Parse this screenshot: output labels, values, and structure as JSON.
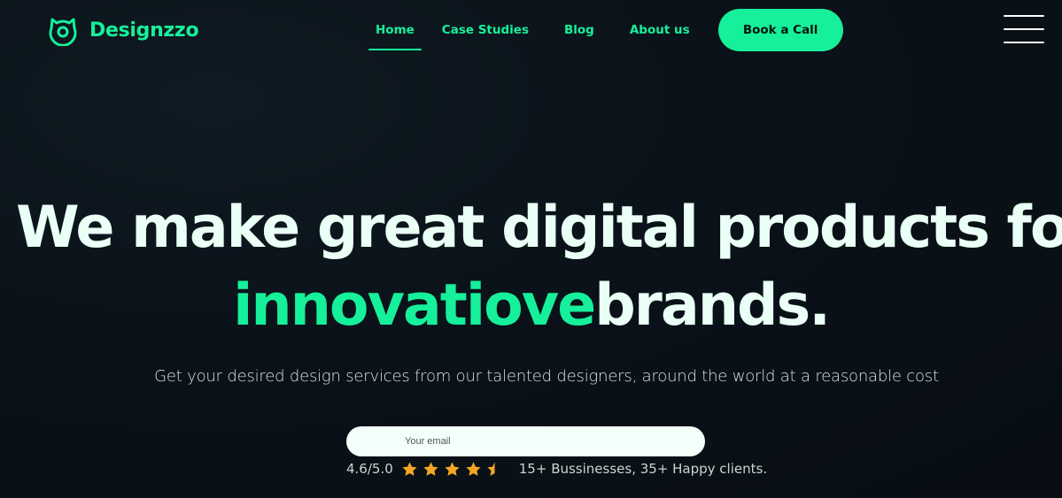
{
  "brand": {
    "name": "Designzzo",
    "accent": "#16f09a",
    "background": "#0a1118"
  },
  "nav": {
    "items": [
      {
        "label": "Home",
        "active": true
      },
      {
        "label": "Case Studies",
        "active": false
      },
      {
        "label": "Blog",
        "active": false
      },
      {
        "label": "About us",
        "active": false
      }
    ],
    "cta_label": "Book a Call",
    "menu_icon": "hamburger-menu-icon"
  },
  "hero": {
    "line1": "We make great digital products for",
    "line2_accent": "innovatiove",
    "line2_rest": "brands.",
    "subtitle": "Get your desired design services from our talented designers, around the world at a reasonable cost",
    "email_placeholder": "Your email",
    "rating": {
      "score": "4.6/5.0",
      "stars_value": 4.5,
      "stars_max": 5,
      "star_color": "#f5a623",
      "clients_text": "15+ Bussinesses, 35+ Happy clients."
    }
  }
}
